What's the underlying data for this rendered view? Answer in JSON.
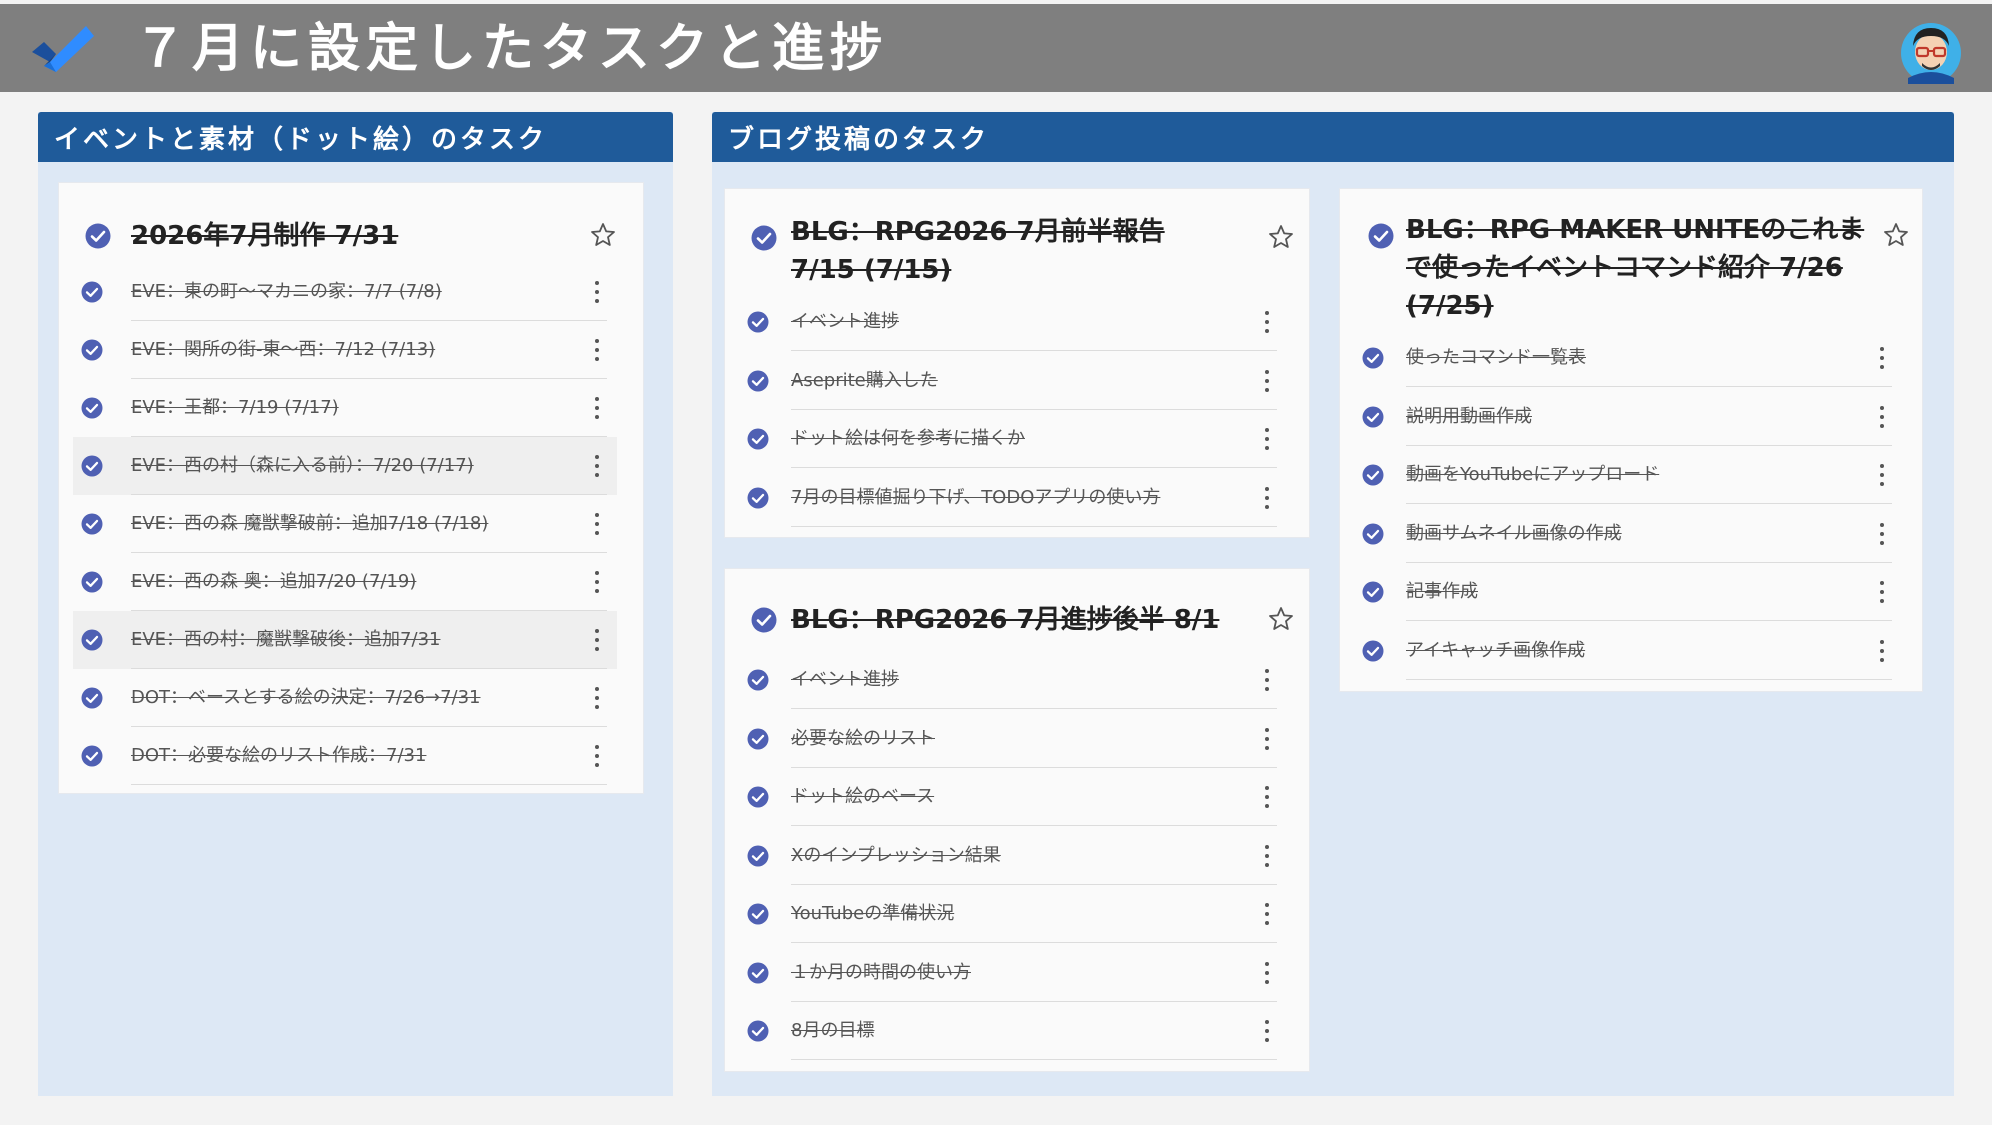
{
  "header": {
    "title": "７月に設定したタスクと進捗"
  },
  "colors": {
    "header_bg": "#7f7f7f",
    "panel_head": "#1f5b9a",
    "panel_bg": "#dde8f5",
    "check": "#4f60b3"
  },
  "panels": [
    {
      "title": "イベントと素材（ドット絵）のタスク",
      "cards": [
        {
          "title": "2026年7月制作 7/31",
          "tasks": [
            "EVE：東の町～マカニの家：7/7 (7/8)",
            "EVE：関所の街-東～西：7/12 (7/13)",
            "EVE：王都：7/19 (7/17)",
            "EVE：西の村（森に入る前）：7/20 (7/17)",
            "EVE：西の森 魔獣撃破前：追加7/18 (7/18)",
            "EVE：西の森 奥：追加7/20 (7/19)",
            "EVE：西の村：魔獣撃破後：追加7/31",
            "DOT：ベースとする絵の決定：7/26→7/31",
            "DOT：必要な絵のリスト作成：7/31"
          ]
        }
      ]
    },
    {
      "title": "ブログ投稿のタスク",
      "cards": [
        {
          "title_lines": [
            "BLG：RPG2026 7月前半報告",
            "7/15 (7/15)"
          ],
          "tasks": [
            "イベント進捗",
            "Aseprite購入した",
            "ドット絵は何を参考に描くか",
            "7月の目標値掘り下げ、TODOアプリの使い方"
          ]
        },
        {
          "title": "BLG：RPG2026 7月進捗後半 8/1",
          "tasks": [
            "イベント進捗",
            "必要な絵のリスト",
            "ドット絵のベース",
            "Xのインプレッション結果",
            "YouTubeの準備状況",
            "１か月の時間の使い方",
            "8月の目標"
          ]
        },
        {
          "title_lines": [
            "BLG：RPG MAKER UNITEのこれま",
            "で使ったイベントコマンド紹介 7/26",
            "(7/25)"
          ],
          "tasks": [
            "使ったコマンド一覧表",
            "説明用動画作成",
            "動画をYouTubeにアップロード",
            "動画サムネイル画像の作成",
            "記事作成",
            "アイキャッチ画像作成"
          ]
        }
      ]
    }
  ]
}
